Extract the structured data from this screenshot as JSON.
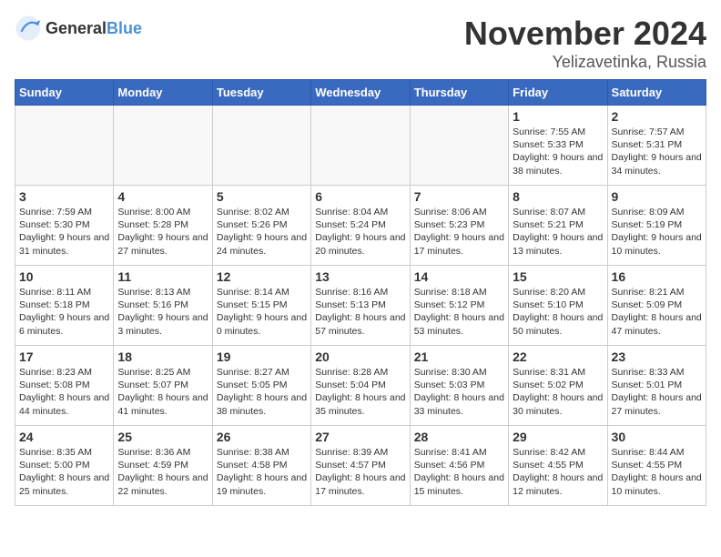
{
  "logo": {
    "text_general": "General",
    "text_blue": "Blue"
  },
  "title": "November 2024",
  "location": "Yelizavetinka, Russia",
  "days_of_week": [
    "Sunday",
    "Monday",
    "Tuesday",
    "Wednesday",
    "Thursday",
    "Friday",
    "Saturday"
  ],
  "weeks": [
    [
      {
        "day": "",
        "empty": true
      },
      {
        "day": "",
        "empty": true
      },
      {
        "day": "",
        "empty": true
      },
      {
        "day": "",
        "empty": true
      },
      {
        "day": "",
        "empty": true
      },
      {
        "day": "1",
        "sunrise": "7:55 AM",
        "sunset": "5:33 PM",
        "daylight": "9 hours and 38 minutes."
      },
      {
        "day": "2",
        "sunrise": "7:57 AM",
        "sunset": "5:31 PM",
        "daylight": "9 hours and 34 minutes."
      }
    ],
    [
      {
        "day": "3",
        "sunrise": "7:59 AM",
        "sunset": "5:30 PM",
        "daylight": "9 hours and 31 minutes."
      },
      {
        "day": "4",
        "sunrise": "8:00 AM",
        "sunset": "5:28 PM",
        "daylight": "9 hours and 27 minutes."
      },
      {
        "day": "5",
        "sunrise": "8:02 AM",
        "sunset": "5:26 PM",
        "daylight": "9 hours and 24 minutes."
      },
      {
        "day": "6",
        "sunrise": "8:04 AM",
        "sunset": "5:24 PM",
        "daylight": "9 hours and 20 minutes."
      },
      {
        "day": "7",
        "sunrise": "8:06 AM",
        "sunset": "5:23 PM",
        "daylight": "9 hours and 17 minutes."
      },
      {
        "day": "8",
        "sunrise": "8:07 AM",
        "sunset": "5:21 PM",
        "daylight": "9 hours and 13 minutes."
      },
      {
        "day": "9",
        "sunrise": "8:09 AM",
        "sunset": "5:19 PM",
        "daylight": "9 hours and 10 minutes."
      }
    ],
    [
      {
        "day": "10",
        "sunrise": "8:11 AM",
        "sunset": "5:18 PM",
        "daylight": "9 hours and 6 minutes."
      },
      {
        "day": "11",
        "sunrise": "8:13 AM",
        "sunset": "5:16 PM",
        "daylight": "9 hours and 3 minutes."
      },
      {
        "day": "12",
        "sunrise": "8:14 AM",
        "sunset": "5:15 PM",
        "daylight": "9 hours and 0 minutes."
      },
      {
        "day": "13",
        "sunrise": "8:16 AM",
        "sunset": "5:13 PM",
        "daylight": "8 hours and 57 minutes."
      },
      {
        "day": "14",
        "sunrise": "8:18 AM",
        "sunset": "5:12 PM",
        "daylight": "8 hours and 53 minutes."
      },
      {
        "day": "15",
        "sunrise": "8:20 AM",
        "sunset": "5:10 PM",
        "daylight": "8 hours and 50 minutes."
      },
      {
        "day": "16",
        "sunrise": "8:21 AM",
        "sunset": "5:09 PM",
        "daylight": "8 hours and 47 minutes."
      }
    ],
    [
      {
        "day": "17",
        "sunrise": "8:23 AM",
        "sunset": "5:08 PM",
        "daylight": "8 hours and 44 minutes."
      },
      {
        "day": "18",
        "sunrise": "8:25 AM",
        "sunset": "5:07 PM",
        "daylight": "8 hours and 41 minutes."
      },
      {
        "day": "19",
        "sunrise": "8:27 AM",
        "sunset": "5:05 PM",
        "daylight": "8 hours and 38 minutes."
      },
      {
        "day": "20",
        "sunrise": "8:28 AM",
        "sunset": "5:04 PM",
        "daylight": "8 hours and 35 minutes."
      },
      {
        "day": "21",
        "sunrise": "8:30 AM",
        "sunset": "5:03 PM",
        "daylight": "8 hours and 33 minutes."
      },
      {
        "day": "22",
        "sunrise": "8:31 AM",
        "sunset": "5:02 PM",
        "daylight": "8 hours and 30 minutes."
      },
      {
        "day": "23",
        "sunrise": "8:33 AM",
        "sunset": "5:01 PM",
        "daylight": "8 hours and 27 minutes."
      }
    ],
    [
      {
        "day": "24",
        "sunrise": "8:35 AM",
        "sunset": "5:00 PM",
        "daylight": "8 hours and 25 minutes."
      },
      {
        "day": "25",
        "sunrise": "8:36 AM",
        "sunset": "4:59 PM",
        "daylight": "8 hours and 22 minutes."
      },
      {
        "day": "26",
        "sunrise": "8:38 AM",
        "sunset": "4:58 PM",
        "daylight": "8 hours and 19 minutes."
      },
      {
        "day": "27",
        "sunrise": "8:39 AM",
        "sunset": "4:57 PM",
        "daylight": "8 hours and 17 minutes."
      },
      {
        "day": "28",
        "sunrise": "8:41 AM",
        "sunset": "4:56 PM",
        "daylight": "8 hours and 15 minutes."
      },
      {
        "day": "29",
        "sunrise": "8:42 AM",
        "sunset": "4:55 PM",
        "daylight": "8 hours and 12 minutes."
      },
      {
        "day": "30",
        "sunrise": "8:44 AM",
        "sunset": "4:55 PM",
        "daylight": "8 hours and 10 minutes."
      }
    ]
  ]
}
